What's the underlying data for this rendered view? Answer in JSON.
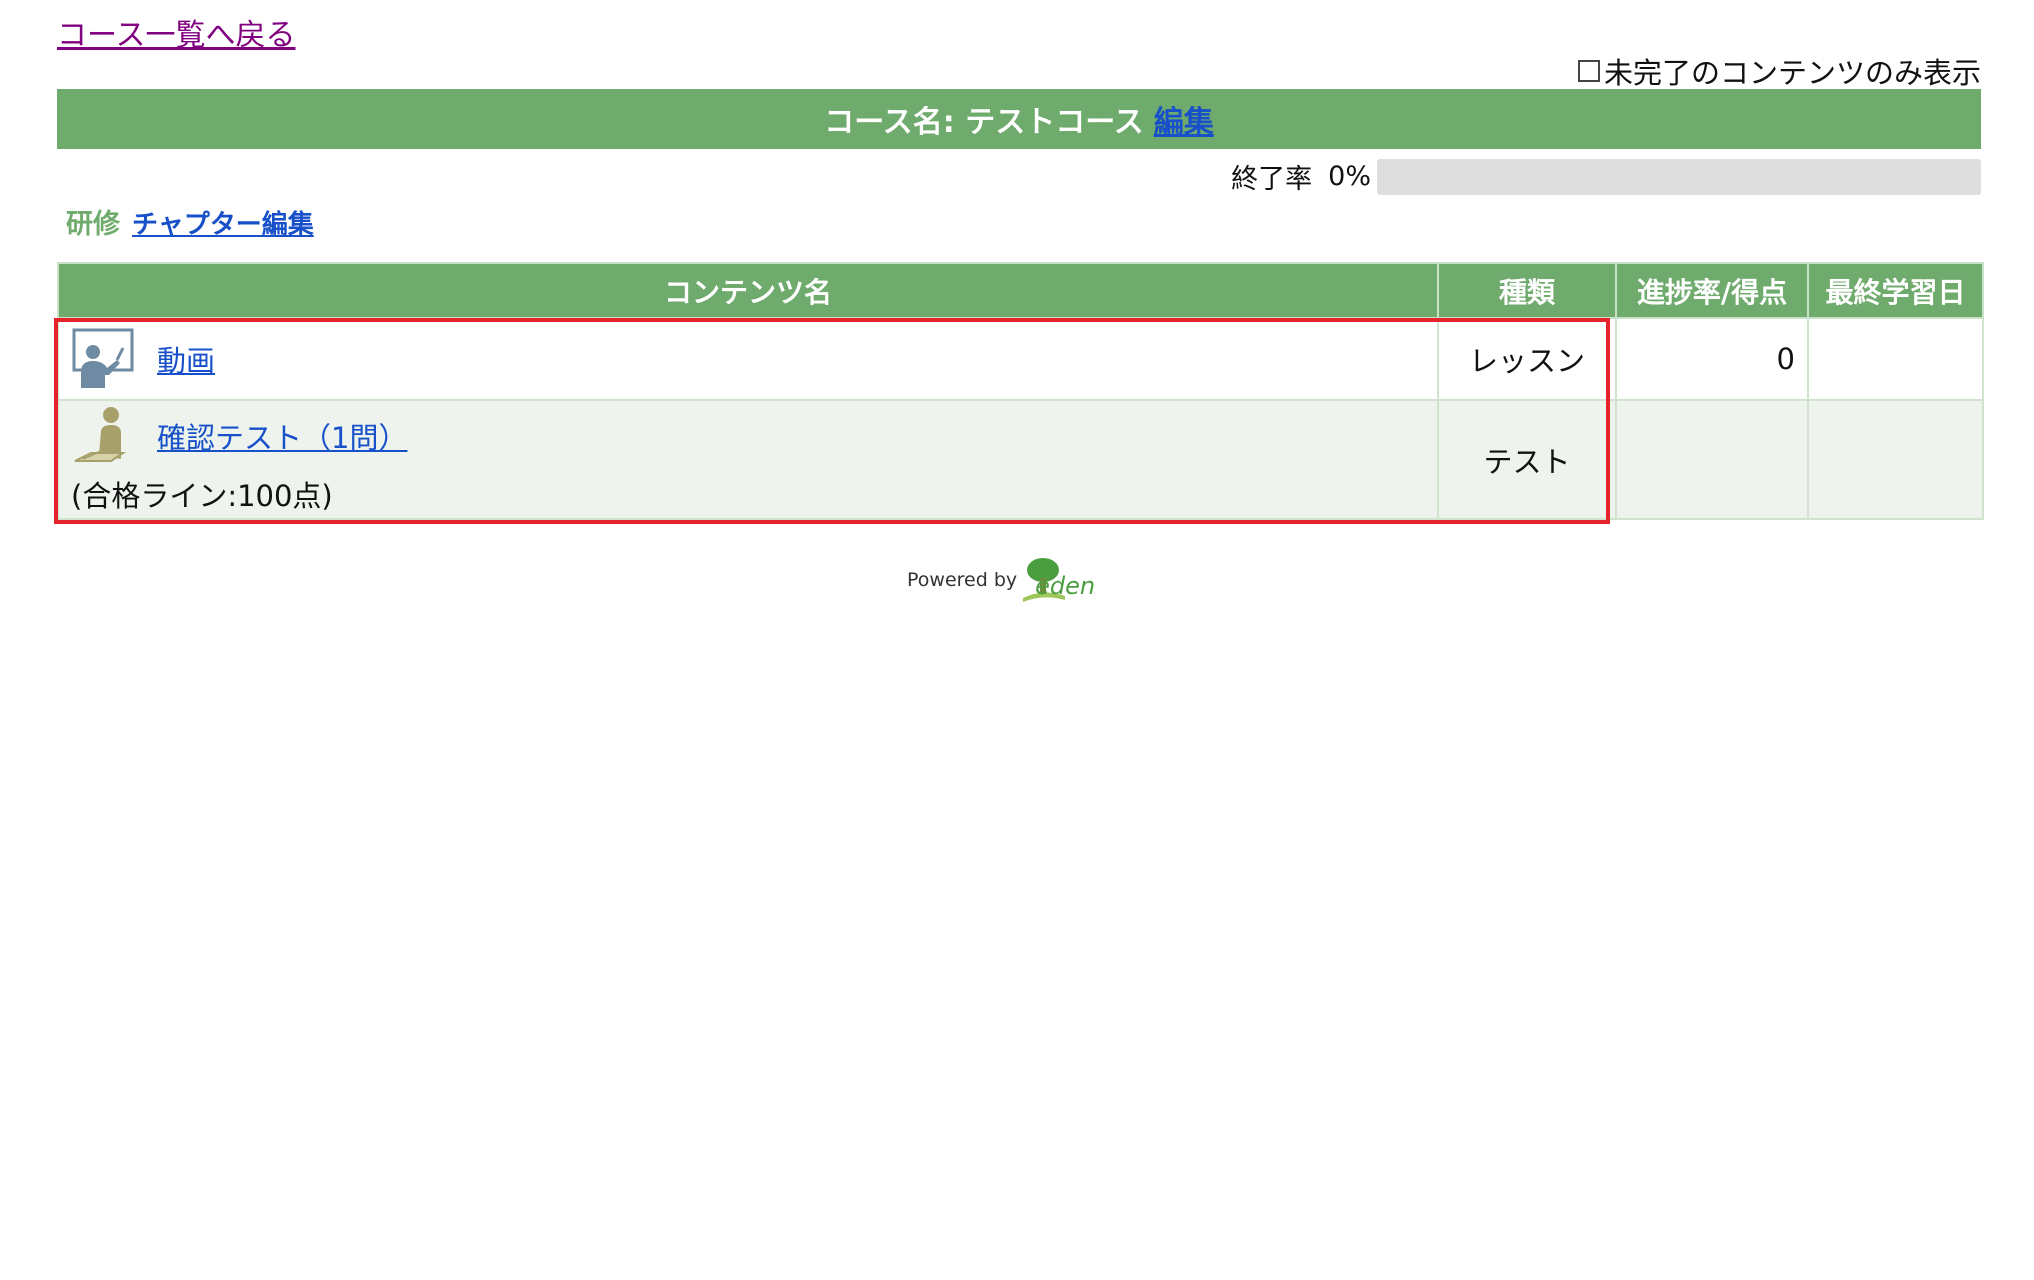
{
  "nav": {
    "back_label": "コース一覧へ戻る"
  },
  "filter": {
    "label": "未完了のコンテンツのみ表示",
    "checked": false
  },
  "course": {
    "title": "コース名: テストコース",
    "edit_label": "編集"
  },
  "completion": {
    "label": "終了率",
    "percent_text": "0%",
    "percent": 0
  },
  "chapter": {
    "title": "研修",
    "edit_label": "チャプター編集"
  },
  "table": {
    "headers": [
      "コンテンツ名",
      "種類",
      "進捗率/得点",
      "最終学習日"
    ],
    "rows": [
      {
        "icon": "lecture-icon",
        "name": "動画",
        "note": "",
        "type": "レッスン",
        "progress": "0",
        "last_date": ""
      },
      {
        "icon": "test-taker-icon",
        "name": "確認テスト（1問）",
        "note": "(合格ライン:100点)",
        "type": "テスト",
        "progress": "",
        "last_date": ""
      }
    ]
  },
  "footer": {
    "powered_by": "Powered by",
    "brand": "eden"
  },
  "colors": {
    "header_green": "#6fab6c",
    "link_blue": "#1750c8",
    "visited": "#800080",
    "highlight_red": "#e4232a"
  }
}
